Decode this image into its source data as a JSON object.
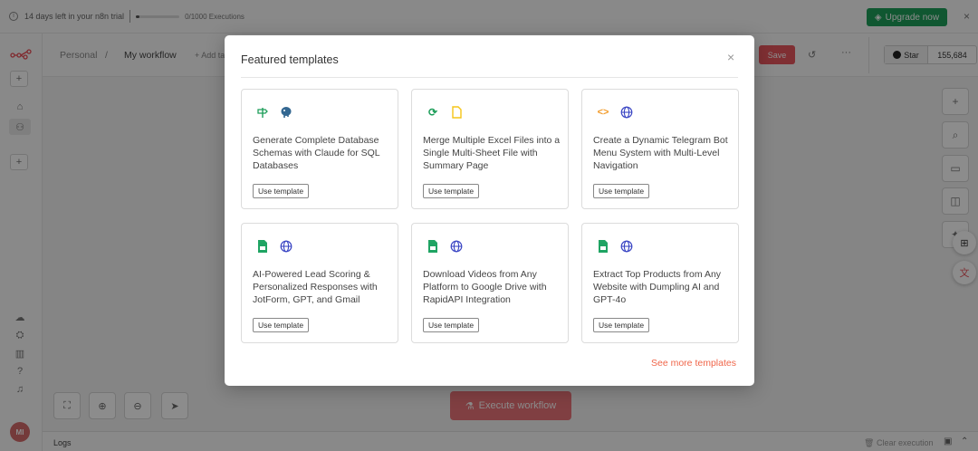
{
  "banner": {
    "trial_text": "14 days left in your n8n trial",
    "executions_text": "0/1000 Executions",
    "executions_used_fraction": 0.0,
    "upgrade_label": "Upgrade now"
  },
  "header": {
    "project": "Personal",
    "workflow": "My workflow",
    "add_tag": "+ Add tag",
    "save_label": "Save",
    "github_star_label": "Star",
    "github_star_count": "155,684"
  },
  "modal": {
    "title": "Featured templates",
    "see_more": "See more templates",
    "use_label": "Use template",
    "templates": [
      {
        "title": "Generate Complete Database Schemas with Claude for SQL Databases",
        "icons": [
          "signpost-icon",
          "postgres-elephant-icon"
        ]
      },
      {
        "title": "Merge Multiple Excel Files into a Single Multi-Sheet File with Summary Page",
        "icons": [
          "refresh-icon",
          "file-icon"
        ]
      },
      {
        "title": "Create a Dynamic Telegram Bot Menu System with Multi-Level Navigation",
        "icons": [
          "code-icon",
          "globe-icon"
        ]
      },
      {
        "title": "AI-Powered Lead Scoring & Personalized Responses with JotForm, GPT, and Gmail",
        "icons": [
          "google-sheets-icon",
          "globe-icon"
        ]
      },
      {
        "title": "Download Videos from Any Platform to Google Drive with RapidAPI Integration",
        "icons": [
          "google-sheets-icon",
          "globe-icon"
        ]
      },
      {
        "title": "Extract Top Products from Any Website with Dumpling AI and GPT-4o",
        "icons": [
          "google-sheets-icon",
          "globe-icon"
        ]
      }
    ]
  },
  "canvas": {
    "execute_label": "Execute workflow"
  },
  "logs": {
    "label": "Logs",
    "clear_label": "Clear execution"
  },
  "sidebar": {
    "avatar_initials": "MI"
  },
  "colors": {
    "brand_red": "#ea4b54",
    "upgrade_green": "#1e9e5a",
    "see_more_orange": "#f0664a"
  }
}
